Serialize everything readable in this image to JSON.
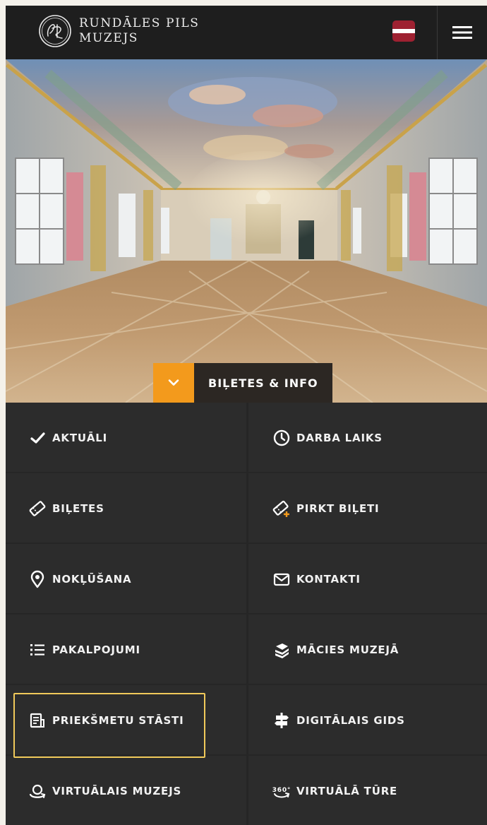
{
  "header": {
    "logo_line1": "RUNDĀLES PILS",
    "logo_line2": "MUZEJS",
    "language_flag": "latvia-flag",
    "menu_icon": "hamburger-menu-icon"
  },
  "hero": {
    "image": "palace-ballroom-photo",
    "tickets_toggle_icon": "chevron-down-icon",
    "tickets_label": "BIĻETES & INFO"
  },
  "menu": [
    {
      "label": "AKTUĀLI",
      "icon": "check-icon"
    },
    {
      "label": "DARBA LAIKS",
      "icon": "clock-icon"
    },
    {
      "label": "BIĻETES",
      "icon": "ticket-icon"
    },
    {
      "label": "PIRKT BIĻETI",
      "icon": "ticket-plus-icon"
    },
    {
      "label": "NOKĻŪŠANA",
      "icon": "location-pin-icon"
    },
    {
      "label": "KONTAKTI",
      "icon": "envelope-icon"
    },
    {
      "label": "PAKALPOJUMI",
      "icon": "list-icon"
    },
    {
      "label": "MĀCIES MUZEJĀ",
      "icon": "books-icon"
    },
    {
      "label": "PRIEKŠMETU STĀSTI",
      "icon": "document-icon"
    },
    {
      "label": "DIGITĀLAIS GIDS",
      "icon": "signpost-icon"
    },
    {
      "label": "VIRTUĀLAIS MUZEJS",
      "icon": "virtual-museum-icon"
    },
    {
      "label": "VIRTUĀLĀ TŪRE",
      "icon": "360-tour-icon"
    }
  ],
  "colors": {
    "accent": "#f39a1c",
    "header_bg": "#1e1e1e",
    "grid_bg": "#2c2c2c",
    "focus_outline": "#f0c95a"
  }
}
